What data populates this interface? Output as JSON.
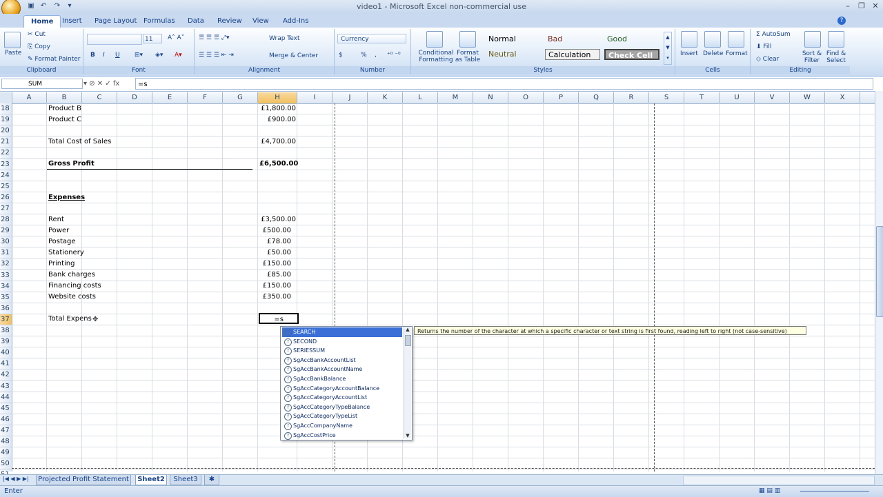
{
  "window": {
    "title": "video1 - Microsoft Excel non-commercial use"
  },
  "tabs": [
    "Home",
    "Insert",
    "Page Layout",
    "Formulas",
    "Data",
    "Review",
    "View",
    "Add-Ins"
  ],
  "ribbon": {
    "clipboard": {
      "paste": "Paste",
      "cut": "Cut",
      "copy": "Copy",
      "format_painter": "Format Painter",
      "label": "Clipboard"
    },
    "font": {
      "size": "11",
      "bold": "B",
      "italic": "I",
      "underline": "U",
      "label": "Font"
    },
    "alignment": {
      "wrap": "Wrap Text",
      "merge": "Merge & Center",
      "label": "Alignment"
    },
    "number": {
      "format": "Currency",
      "label": "Number",
      "currency_sym": "$",
      "percent": "%",
      "comma": ","
    },
    "styles": {
      "conditional": "Conditional Formatting",
      "format_table": "Format as Table",
      "normal": "Normal",
      "bad": "Bad",
      "good": "Good",
      "neutral": "Neutral",
      "calculation": "Calculation",
      "check_cell": "Check Cell",
      "label": "Styles"
    },
    "cells": {
      "insert": "Insert",
      "delete": "Delete",
      "format": "Format",
      "label": "Cells"
    },
    "editing": {
      "autosum": "AutoSum",
      "fill": "Fill",
      "clear": "Clear",
      "sort": "Sort & Filter",
      "find": "Find & Select",
      "label": "Editing"
    }
  },
  "formula_bar": {
    "name_box": "SUM",
    "formula": "=s"
  },
  "columns": [
    "A",
    "B",
    "C",
    "D",
    "E",
    "F",
    "G",
    "H",
    "I",
    "J",
    "K",
    "L",
    "M",
    "N",
    "O",
    "P",
    "Q",
    "R",
    "S",
    "T",
    "U",
    "V",
    "W",
    "X"
  ],
  "selected_column": "H",
  "rows": [
    "18",
    "19",
    "20",
    "21",
    "22",
    "23",
    "24",
    "25",
    "26",
    "27",
    "28",
    "29",
    "30",
    "31",
    "32",
    "33",
    "34",
    "35",
    "36",
    "37",
    "38",
    "39",
    "40",
    "41",
    "42",
    "43",
    "44",
    "45",
    "46",
    "47",
    "48",
    "49",
    "50",
    "51"
  ],
  "selected_row": "37",
  "cells": {
    "b18": "Product B",
    "h18": "£1,800.00",
    "b19": "Product C",
    "h19": "£900.00",
    "b21": "Total Cost of Sales",
    "h21": "£4,700.00",
    "b23": "Gross Profit",
    "h23": "£6,500.00",
    "b26": "Expenses",
    "b28": "Rent",
    "h28": "£3,500.00",
    "b29": "Power",
    "h29": "£500.00",
    "b30": "Postage",
    "h30": "£78.00",
    "b31": "Stationery",
    "h31": "£50.00",
    "b32": "Printing",
    "h32": "£150.00",
    "b33": "Bank charges",
    "h33": "£85.00",
    "b34": "Financing costs",
    "h34": "£150.00",
    "b35": "Website costs",
    "h35": "£350.00",
    "b37": "Total Expens",
    "h37": "=s"
  },
  "autocomplete": [
    "SEARCH",
    "SECOND",
    "SERIESSUM",
    "SgAccBankAccountList",
    "SgAccBankAccountName",
    "SgAccBankBalance",
    "SgAccCategoryAccountBalance",
    "SgAccCategoryAccountList",
    "SgAccCategoryTypeBalance",
    "SgAccCategoryTypeList",
    "SgAccCompanyName",
    "SgAccCostPrice"
  ],
  "tooltip": "Returns the number of the character at which a specific character or text string is first found, reading left to right (not case-sensitive)",
  "sheets": [
    "Projected Profit Statement",
    "Sheet2",
    "Sheet3"
  ],
  "active_sheet": "Sheet2",
  "status": "Enter"
}
